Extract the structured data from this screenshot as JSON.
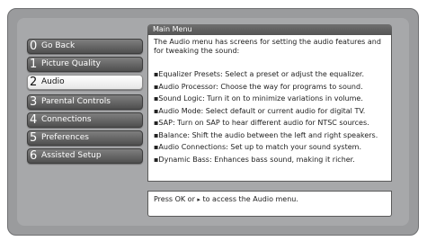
{
  "menu": {
    "items": [
      {
        "number": "0",
        "label": "Go Back"
      },
      {
        "number": "1",
        "label": "Picture Quality"
      },
      {
        "number": "2",
        "label": "Audio"
      },
      {
        "number": "3",
        "label": "Parental Controls"
      },
      {
        "number": "4",
        "label": "Connections"
      },
      {
        "number": "5",
        "label": "Preferences"
      },
      {
        "number": "6",
        "label": "Assisted Setup"
      }
    ],
    "selected_index": 2
  },
  "panel": {
    "title": "Main Menu",
    "intro": "The Audio menu has screens for setting the audio features and for tweaking the sound:",
    "bullets": [
      "▪Equalizer Presets: Select a preset or adjust the equalizer.",
      "▪Audio Processor: Choose the way for programs to sound.",
      "▪Sound Logic: Turn it on to minimize variations in volume.",
      "▪Audio Mode: Select default or current audio for digital TV.",
      "▪SAP: Turn on SAP to hear different audio for NTSC sources.",
      "▪Balance: Shift the audio between the left and right speakers.",
      "▪Audio Connections: Set up to match your sound system.",
      "▪Dynamic Bass: Enhances bass sound, making it richer."
    ]
  },
  "footer": {
    "prefix": "Press OK or",
    "arrow_icon": "▸",
    "suffix": "to access the Audio menu."
  }
}
